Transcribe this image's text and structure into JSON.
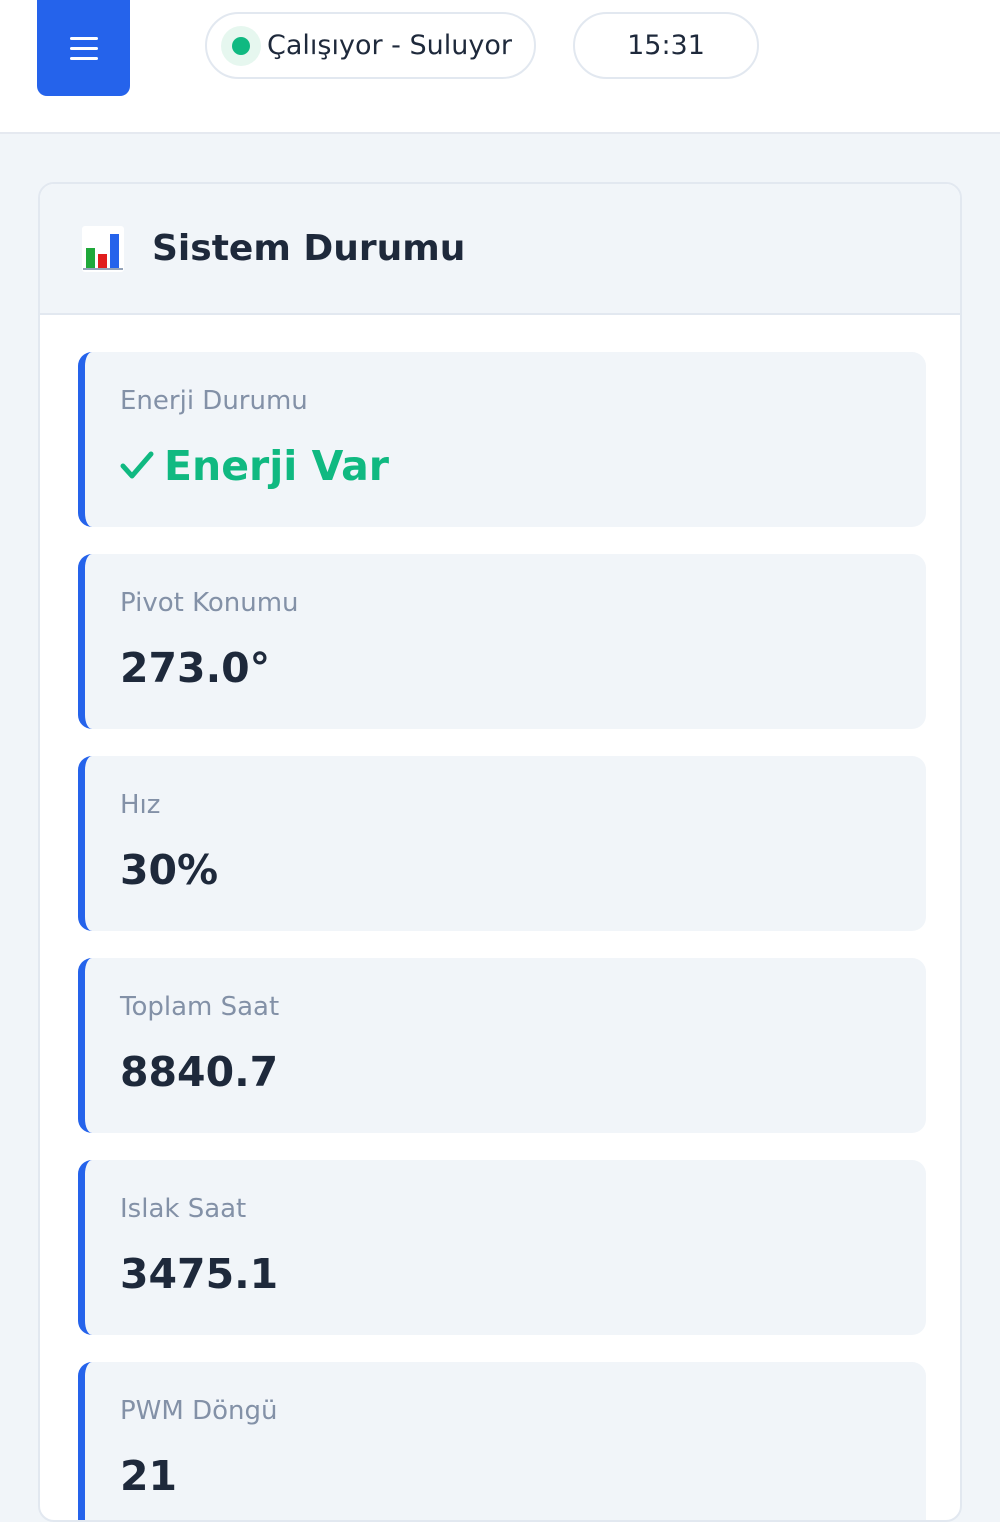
{
  "header": {
    "status_text": "Çalışıyor - Suluyor",
    "time": "15:31"
  },
  "panel": {
    "title": "Sistem Durumu",
    "icon": "bar-chart-icon"
  },
  "cards": [
    {
      "label": "Enerji Durumu",
      "value": "Enerji Var",
      "icon": "check-icon",
      "value_color": "#10b981"
    },
    {
      "label": "Pivot Konumu",
      "value": "273.0°"
    },
    {
      "label": "Hız",
      "value": "30%"
    },
    {
      "label": "Toplam Saat",
      "value": "8840.7"
    },
    {
      "label": "Islak Saat",
      "value": "3475.1"
    },
    {
      "label": "PWM Döngü",
      "value": "21"
    }
  ],
  "colors": {
    "accent": "#2563eb",
    "success": "#10b981",
    "background": "#f1f5f9",
    "text": "#1e293b",
    "label": "#8391a7"
  }
}
